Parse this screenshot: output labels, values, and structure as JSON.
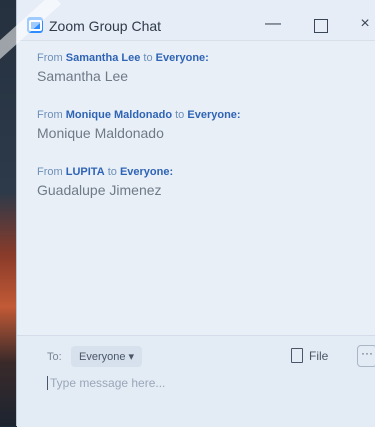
{
  "window": {
    "title": "Zoom Group Chat",
    "controls": {
      "minimize": "—",
      "maximize": "",
      "close": "×"
    }
  },
  "messages": [
    {
      "from_prefix": "From",
      "sender": "Samantha Lee",
      "to_prefix": "to",
      "recipient": "Everyone:",
      "text": "Samantha Lee"
    },
    {
      "from_prefix": "From",
      "sender": "Monique Maldonado",
      "to_prefix": "to",
      "recipient": "Everyone:",
      "text": "Monique Maldonado"
    },
    {
      "from_prefix": "From",
      "sender": "LUPITA",
      "to_prefix": "to",
      "recipient": "Everyone:",
      "text": "Guadalupe Jimenez"
    }
  ],
  "composer": {
    "to_label": "To:",
    "recipient": "Everyone",
    "file_label": "File",
    "more_label": "···",
    "placeholder": "Type message here..."
  },
  "colors": {
    "accent": "#2d8cff",
    "sender": "#2f64b5"
  }
}
